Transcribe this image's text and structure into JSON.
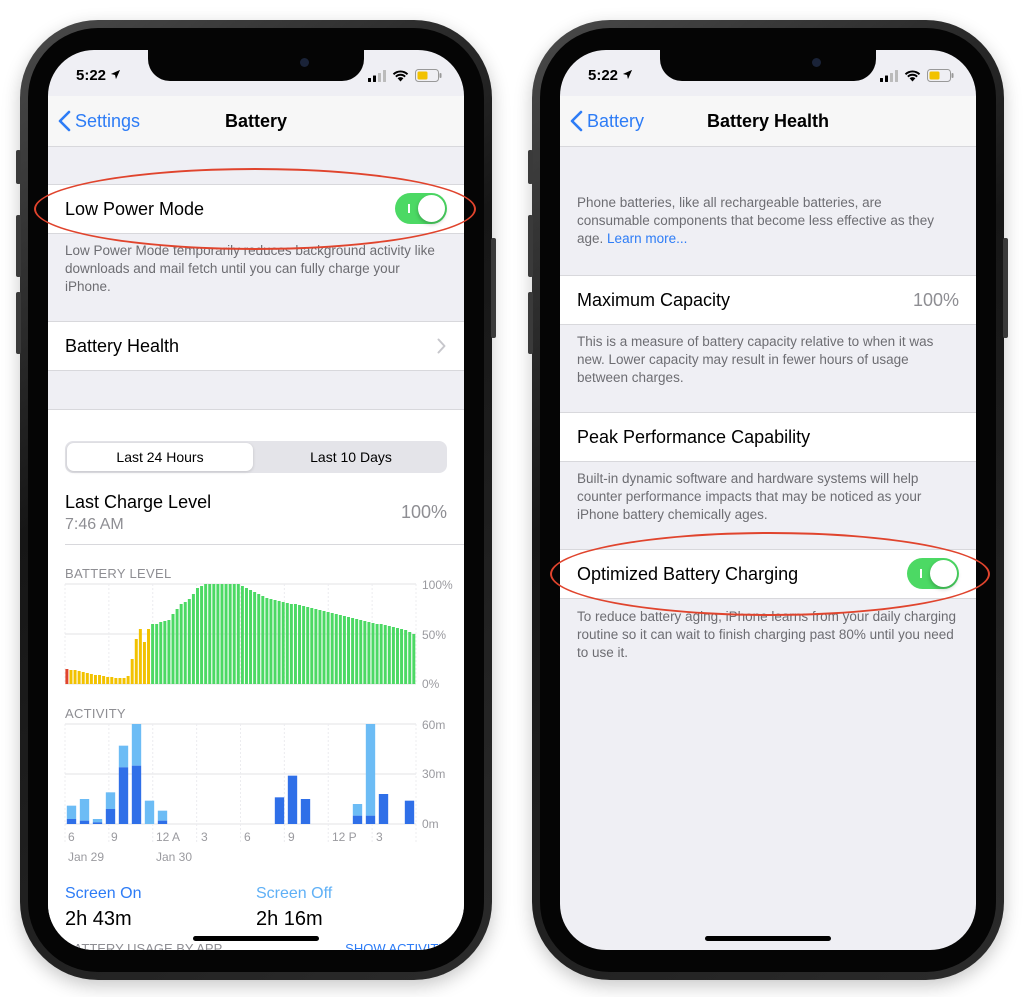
{
  "status": {
    "time": "5:22"
  },
  "left": {
    "nav": {
      "back": "Settings",
      "title": "Battery"
    },
    "low_power": {
      "label": "Low Power Mode",
      "on": true
    },
    "low_power_desc": "Low Power Mode temporarily reduces background activity like downloads and mail fetch until you can fully charge your iPhone.",
    "battery_health": {
      "label": "Battery Health"
    },
    "segment": {
      "options": [
        "Last 24 Hours",
        "Last 10 Days"
      ],
      "selected": 0
    },
    "last_charge": {
      "label": "Last Charge Level",
      "time": "7:46 AM",
      "value": "100%"
    },
    "battery_level": {
      "title": "BATTERY LEVEL",
      "y_ticks": [
        "100%",
        "50%",
        "0%"
      ],
      "values": [
        15,
        14,
        14,
        13,
        12,
        11,
        10,
        9,
        9,
        8,
        7,
        7,
        6,
        6,
        6,
        8,
        25,
        45,
        55,
        42,
        55,
        60,
        60,
        62,
        63,
        64,
        70,
        75,
        80,
        82,
        85,
        90,
        96,
        98,
        100,
        100,
        100,
        100,
        100,
        100,
        100,
        100,
        100,
        98,
        96,
        94,
        92,
        90,
        88,
        86,
        85,
        84,
        83,
        82,
        81,
        80,
        80,
        79,
        78,
        77,
        76,
        75,
        74,
        73,
        72,
        71,
        70,
        69,
        68,
        67,
        66,
        65,
        64,
        63,
        62,
        61,
        60,
        60,
        59,
        58,
        57,
        56,
        55,
        54,
        52,
        50
      ]
    },
    "activity": {
      "title": "ACTIVITY",
      "y_ticks": [
        "60m",
        "30m",
        "0m"
      ],
      "x_ticks": [
        "6",
        "9",
        "12 A",
        "3",
        "6",
        "9",
        "12 P",
        "3"
      ],
      "x_dates": [
        "Jan 29",
        "Jan 30"
      ],
      "screen_on": [
        3,
        2,
        1,
        9,
        34,
        35,
        0,
        2,
        0,
        0,
        0,
        0,
        0,
        0,
        0,
        0,
        16,
        29,
        15,
        0,
        0,
        0,
        5,
        5,
        18,
        0,
        14
      ],
      "screen_off": [
        8,
        13,
        2,
        10,
        13,
        25,
        14,
        6,
        0,
        0,
        0,
        0,
        0,
        0,
        0,
        0,
        0,
        0,
        0,
        0,
        0,
        0,
        7,
        55,
        0,
        0,
        0
      ]
    },
    "stats": {
      "on_label": "Screen On",
      "on_value": "2h 43m",
      "off_label": "Screen Off",
      "off_value": "2h 16m"
    },
    "usage_label": "BATTERY USAGE BY APP",
    "show_activity": "SHOW ACTIVITY"
  },
  "right": {
    "nav": {
      "back": "Battery",
      "title": "Battery Health"
    },
    "intro": "Phone batteries, like all rechargeable batteries, are consumable components that become less effective as they age.",
    "learn_more": "Learn more...",
    "max_capacity": {
      "label": "Maximum Capacity",
      "value": "100%"
    },
    "max_desc": "This is a measure of battery capacity relative to when it was new. Lower capacity may result in fewer hours of usage between charges.",
    "peak": {
      "label": "Peak Performance Capability"
    },
    "peak_desc": "Built-in dynamic software and hardware systems will help counter performance impacts that may be noticed as your iPhone battery chemically ages.",
    "optimized": {
      "label": "Optimized Battery Charging",
      "on": true
    },
    "optimized_desc": "To reduce battery aging, iPhone learns from your daily charging routine so it can wait to finish charging past 80% until you need to use it."
  },
  "colors": {
    "accent": "#2d7cf6",
    "toggle_on": "#4cd964",
    "highlight": "#e0442d",
    "battery_green": "#4cd964",
    "battery_low": "#f2c200",
    "battery_critical": "#e0442d",
    "screen_on": "#2f6fe8",
    "screen_off": "#6cbcf5"
  }
}
